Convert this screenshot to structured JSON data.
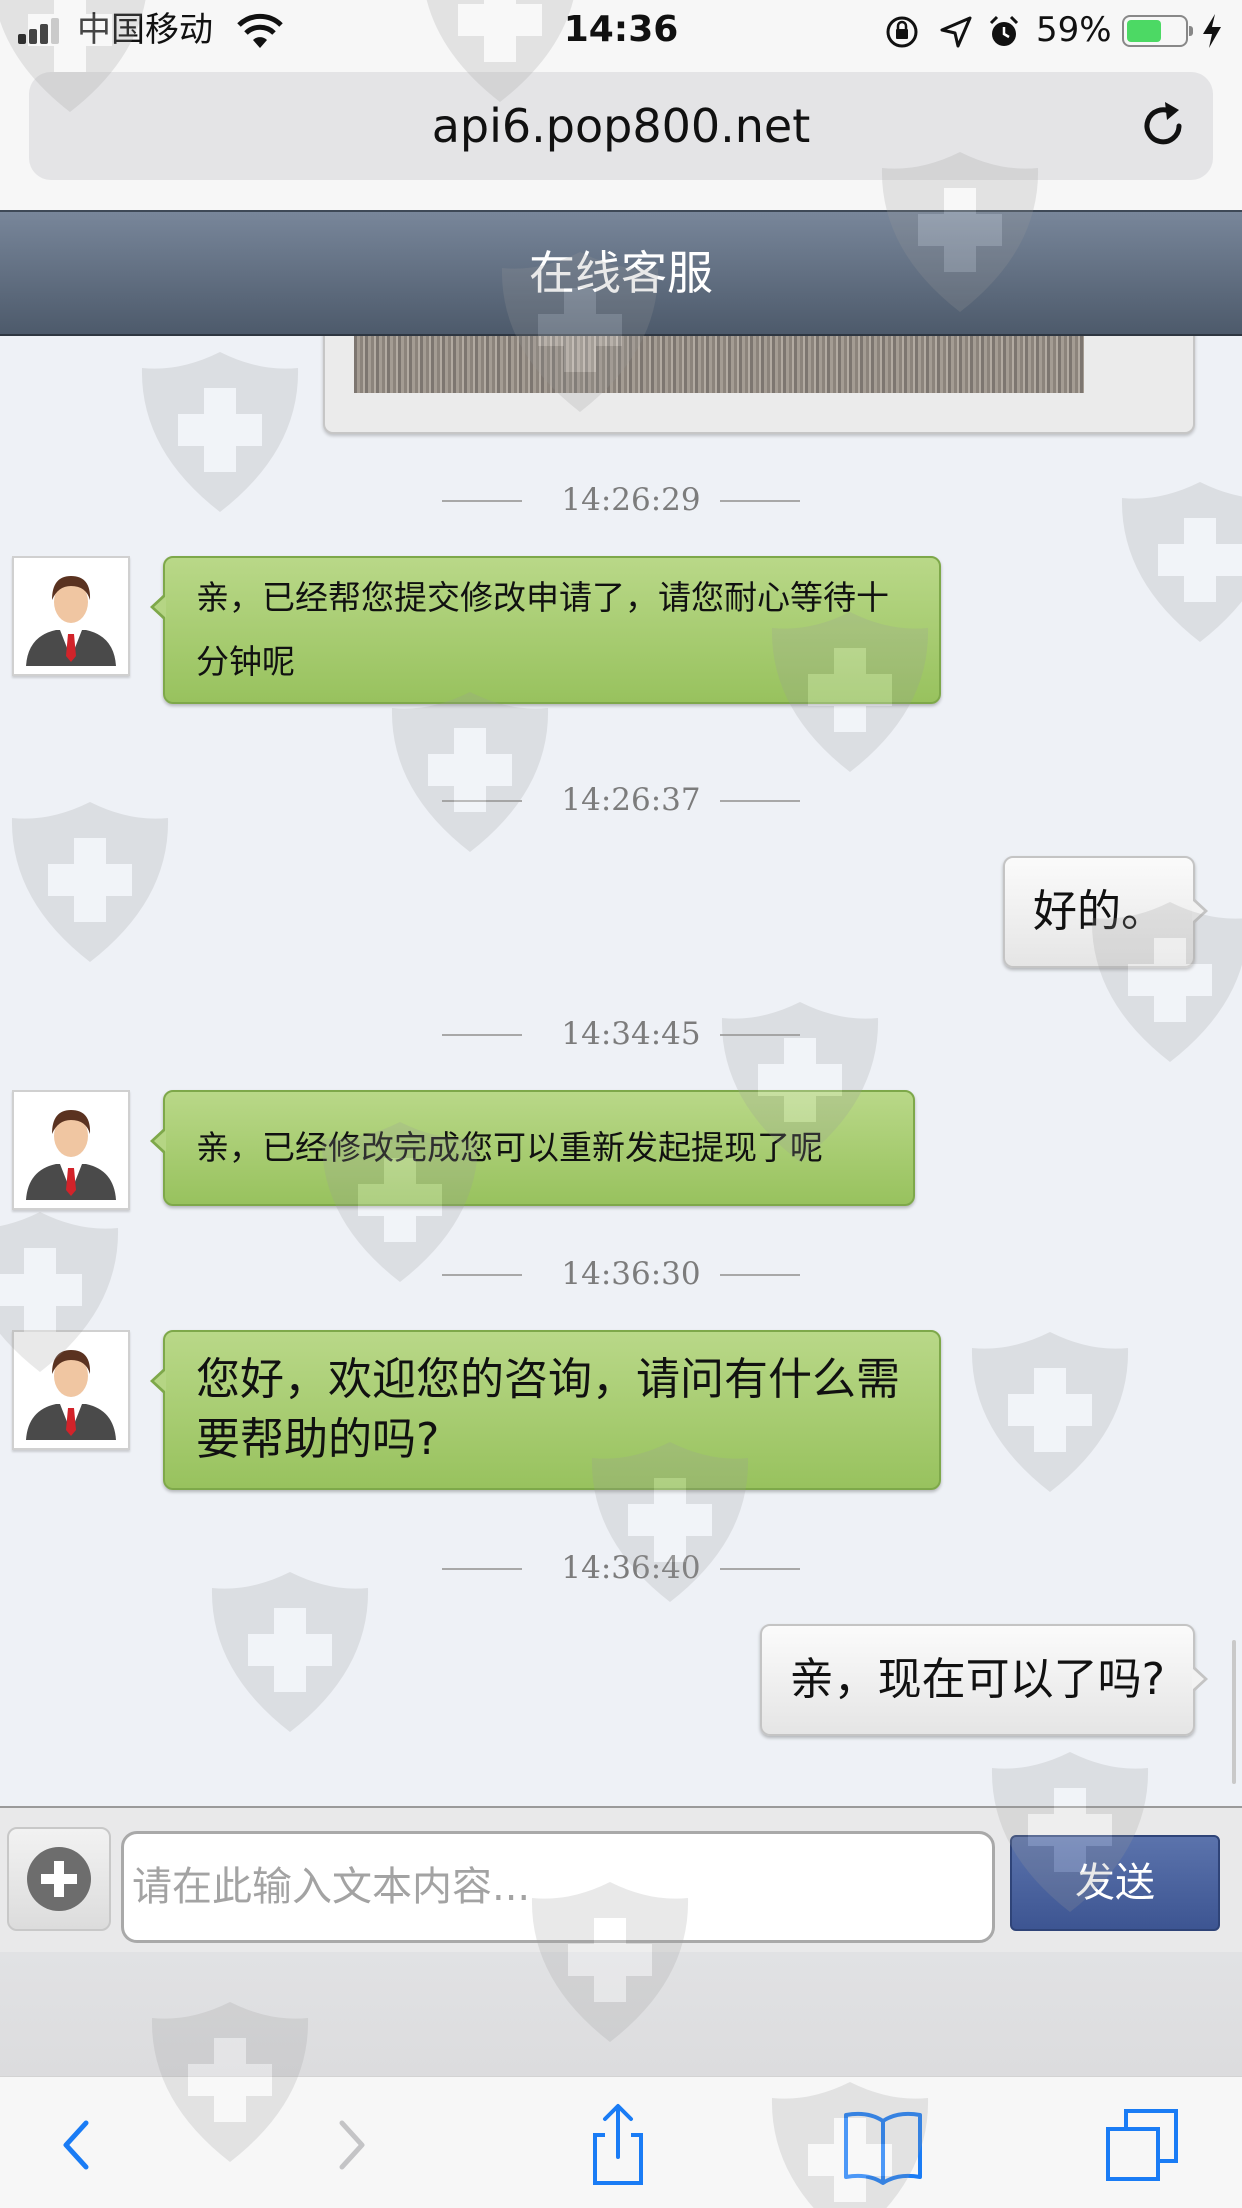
{
  "status_bar": {
    "carrier": "中国移动",
    "time": "14:36",
    "battery_percent": "59%",
    "battery_level": 0.59,
    "icons": [
      "signal-icon",
      "wifi-icon",
      "orientation-lock-icon",
      "location-icon",
      "alarm-icon",
      "battery-icon",
      "charging-icon"
    ]
  },
  "browser": {
    "url": "api6.pop800.net"
  },
  "header": {
    "title": "在线客服"
  },
  "messages": [
    {
      "type": "timestamp",
      "text": "14:26:29"
    },
    {
      "type": "agent",
      "text": "亲，已经帮您提交修改申请了，请您耐心等待十分钟呢"
    },
    {
      "type": "timestamp",
      "text": "14:26:37"
    },
    {
      "type": "user",
      "text": "好的。"
    },
    {
      "type": "timestamp",
      "text": "14:34:45"
    },
    {
      "type": "agent",
      "text": "亲，已经修改完成您可以重新发起提现了呢"
    },
    {
      "type": "timestamp",
      "text": "14:36:30"
    },
    {
      "type": "agent",
      "text": "您好，欢迎您的咨询，请问有什么需要帮助的吗?"
    },
    {
      "type": "timestamp",
      "text": "14:36:40"
    },
    {
      "type": "user",
      "text": "亲，现在可以了吗?"
    }
  ],
  "input": {
    "placeholder": "请在此输入文本内容...",
    "value": "",
    "send_label": "发送"
  },
  "colors": {
    "header": "#5f6c7d",
    "agent_bubble": "#a7cc72",
    "user_bubble": "#f0f0f0",
    "send_button": "#4a63a0",
    "chat_background": "#eef1f6"
  }
}
